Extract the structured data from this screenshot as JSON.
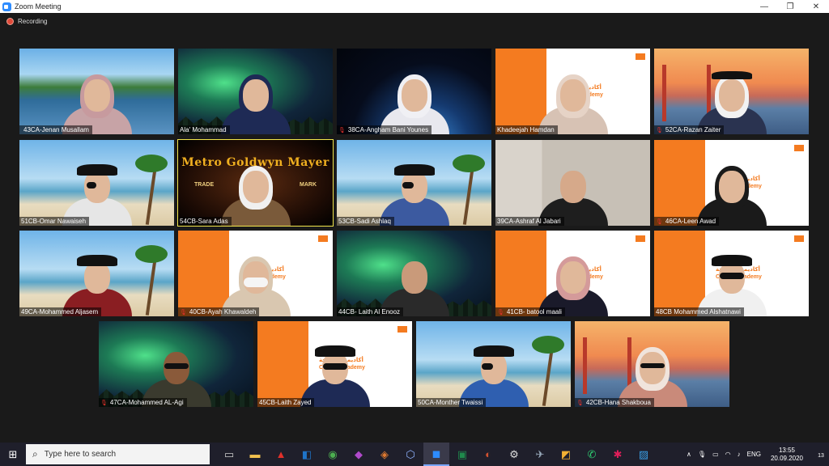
{
  "window": {
    "title": "Zoom Meeting",
    "minimize": "—",
    "maximize": "❐",
    "close": "✕"
  },
  "recording": {
    "label": "Recording"
  },
  "participants": [
    {
      "name": "43CA-Jenan Musallam",
      "muted": false
    },
    {
      "name": "Ala' Mohammad",
      "muted": false
    },
    {
      "name": "38CA-Angham Bani Younes",
      "muted": true
    },
    {
      "name": "Khadeejah Hamdan",
      "muted": false
    },
    {
      "name": "52CA-Razan Zaiter",
      "muted": true
    },
    {
      "name": "51CB-Omar Nawaiseh",
      "muted": false
    },
    {
      "name": "54CB-Sara Adas",
      "muted": false
    },
    {
      "name": "53CB-Sadi Ashlaq",
      "muted": false
    },
    {
      "name": "39CA-Ashraf Al Jabari",
      "muted": false
    },
    {
      "name": "46CA-Leen Awad",
      "muted": true
    },
    {
      "name": "49CA-Mohammed Aljasem",
      "muted": false
    },
    {
      "name": "40CB-Ayah Khawaldeh",
      "muted": true
    },
    {
      "name": "44CB- Laith Al Enooz",
      "muted": false
    },
    {
      "name": "41CB- batool maali",
      "muted": true
    },
    {
      "name": "48CB Mohammed Alshatnawi",
      "muted": false
    },
    {
      "name": "47CA-Mohammed AL-Agi",
      "muted": true
    },
    {
      "name": "45CB-Laith Zayed",
      "muted": false
    },
    {
      "name": "50CA-Monther Twaissi",
      "muted": false
    },
    {
      "name": "42CB-Hana Shakboua",
      "muted": true
    }
  ],
  "backgrounds": {
    "coding_academy_ar": "أكاديمية البرمجة",
    "coding_academy_en": "Coding Academy",
    "mgm_title": "Metro Goldwyn Mayer",
    "mgm_trade": "TRADE",
    "mgm_mark": "MARK"
  },
  "taskbar": {
    "search_placeholder": "Type here to search",
    "language": "ENG",
    "time": "13:55",
    "date": "20.09.2020",
    "notifications": "13"
  }
}
